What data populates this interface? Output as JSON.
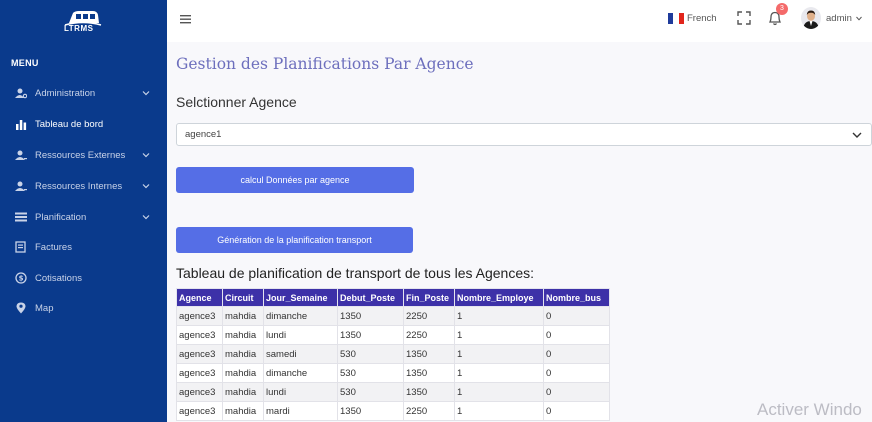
{
  "brand": {
    "logo_text": "LTRMS"
  },
  "sidebar": {
    "menu_title": "MENU",
    "items": [
      {
        "label": "Administration",
        "icon": "users-cog-icon",
        "has_chevron": true
      },
      {
        "label": "Tableau de bord",
        "icon": "bar-chart-icon",
        "has_chevron": false
      },
      {
        "label": "Ressources Externes",
        "icon": "user-icon",
        "has_chevron": true
      },
      {
        "label": "Ressources Internes",
        "icon": "user-icon",
        "has_chevron": true
      },
      {
        "label": "Planification",
        "icon": "list-icon",
        "has_chevron": true
      },
      {
        "label": "Factures",
        "icon": "invoice-icon",
        "has_chevron": false
      },
      {
        "label": "Cotisations",
        "icon": "dollar-circle-icon",
        "has_chevron": false
      },
      {
        "label": "Map",
        "icon": "map-pin-icon",
        "has_chevron": false
      }
    ]
  },
  "header": {
    "language": "French",
    "notification_count": "3",
    "username": "admin"
  },
  "main": {
    "page_title": "Gestion des Planifications Par Agence",
    "select_label": "Selctionner Agence",
    "select_value": "agence1",
    "button_calc": "calcul Données par agence",
    "button_gen": "Génération de la planification transport",
    "table_title": "Tableau de planification de transport de tous les Agences:"
  },
  "table": {
    "columns": [
      "Agence",
      "Circuit",
      "Jour_Semaine",
      "Debut_Poste",
      "Fin_Poste",
      "Nombre_Employe",
      "Nombre_bus"
    ],
    "rows": [
      [
        "agence3",
        "mahdia",
        "dimanche",
        "1350",
        "2250",
        "1",
        "0"
      ],
      [
        "agence3",
        "mahdia",
        "lundi",
        "1350",
        "2250",
        "1",
        "0"
      ],
      [
        "agence3",
        "mahdia",
        "samedi",
        "530",
        "1350",
        "1",
        "0"
      ],
      [
        "agence3",
        "mahdia",
        "dimanche",
        "530",
        "1350",
        "1",
        "0"
      ],
      [
        "agence3",
        "mahdia",
        "lundi",
        "530",
        "1350",
        "1",
        "0"
      ],
      [
        "agence3",
        "mahdia",
        "mardi",
        "1350",
        "2250",
        "1",
        "0"
      ]
    ]
  },
  "watermark": "Activer Windo",
  "colors": {
    "sidebar_bg": "#0a3a8c",
    "accent_button": "#556ee6",
    "table_header": "#3d31a8",
    "title": "#6d6fbd",
    "badge": "#f46a6a"
  }
}
